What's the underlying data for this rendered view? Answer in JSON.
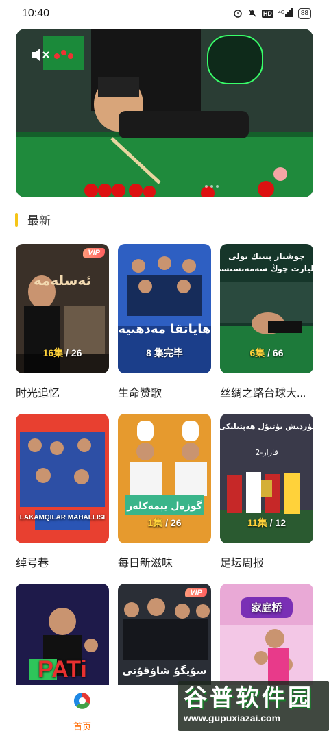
{
  "status_bar": {
    "time": "10:40",
    "network": "4G",
    "hd": "HD",
    "battery": "88"
  },
  "banner": {
    "caption": ""
  },
  "section": {
    "title": "最新"
  },
  "cards": [
    {
      "title": "时光追忆",
      "vip": "VIP",
      "ep_current": "16",
      "ep_unit": "集",
      "ep_total": "/ 26",
      "poster_text": ""
    },
    {
      "title": "生命赞歌",
      "vip": "",
      "ep_current": "8",
      "ep_unit": "集完毕",
      "ep_total": "",
      "poster_text": ""
    },
    {
      "title": "丝绸之路台球大...",
      "vip": "",
      "ep_current": "6",
      "ep_unit": "集",
      "ep_total": "/ 66",
      "poster_text": ""
    },
    {
      "title": "绰号巷",
      "vip": "",
      "ep_current": "",
      "ep_unit": "",
      "ep_total": "",
      "poster_text": "LAKAMQILAR MAHALLISI"
    },
    {
      "title": "每日新滋味",
      "vip": "",
      "ep_current": "1",
      "ep_unit": "集",
      "ep_total": "/ 26",
      "poster_text": ""
    },
    {
      "title": "足坛周报",
      "vip": "",
      "ep_current": "11",
      "ep_unit": "集",
      "ep_total": "/ 12",
      "poster_text": ""
    },
    {
      "title": "",
      "vip": "",
      "ep_current": "",
      "ep_unit": "",
      "ep_total": "",
      "poster_text": "PATi"
    },
    {
      "title": "",
      "vip": "VIP",
      "ep_current": "",
      "ep_unit": "",
      "ep_total": "",
      "poster_text": ""
    },
    {
      "title": "",
      "vip": "",
      "ep_current": "",
      "ep_unit": "",
      "ep_total": "",
      "poster_text": "家庭桥"
    }
  ],
  "bottom_nav": {
    "home_label": "首页"
  },
  "watermark": {
    "title": "谷普软件园",
    "url": "www.gupuxiazai.com"
  },
  "colors": {
    "accent": "#ff6a00",
    "section_bar": "#f5c518",
    "episode_highlight": "#ffd23a"
  },
  "icons": [
    "mute-icon",
    "alarm-icon",
    "bell-off-icon",
    "signal-icon",
    "battery-icon",
    "app-logo-icon"
  ]
}
